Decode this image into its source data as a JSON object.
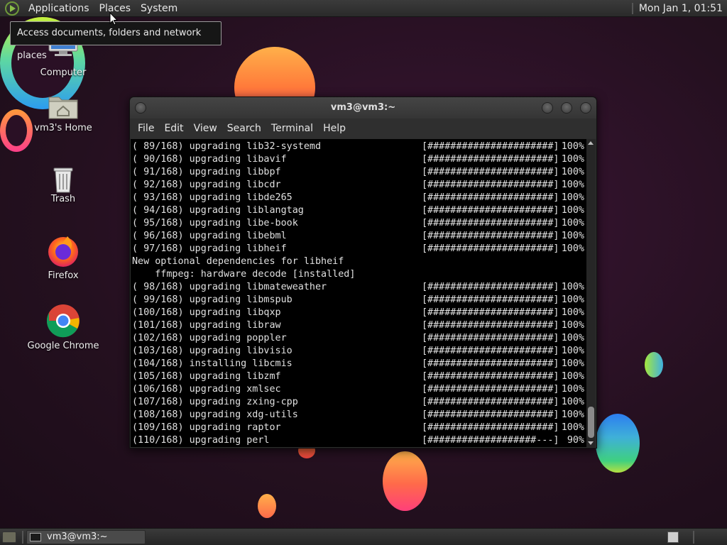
{
  "top_panel": {
    "menus": [
      "Applications",
      "Places",
      "System"
    ],
    "clock": "Mon Jan 1, 01:51"
  },
  "tooltip": "Access documents, folders and network places",
  "desktop_icons": [
    {
      "label": "Computer"
    },
    {
      "label": "vm3's Home"
    },
    {
      "label": "Trash"
    },
    {
      "label": "Firefox"
    },
    {
      "label": "Google Chrome"
    }
  ],
  "terminal": {
    "title": "vm3@vm3:~",
    "menus": [
      "File",
      "Edit",
      "View",
      "Search",
      "Terminal",
      "Help"
    ],
    "lines": [
      {
        "text": "( 89/168) upgrading lib32-systemd",
        "progress": "[######################]",
        "pct": "100%"
      },
      {
        "text": "( 90/168) upgrading libavif",
        "progress": "[######################]",
        "pct": "100%"
      },
      {
        "text": "( 91/168) upgrading libbpf",
        "progress": "[######################]",
        "pct": "100%"
      },
      {
        "text": "( 92/168) upgrading libcdr",
        "progress": "[######################]",
        "pct": "100%"
      },
      {
        "text": "( 93/168) upgrading libde265",
        "progress": "[######################]",
        "pct": "100%"
      },
      {
        "text": "( 94/168) upgrading liblangtag",
        "progress": "[######################]",
        "pct": "100%"
      },
      {
        "text": "( 95/168) upgrading libe-book",
        "progress": "[######################]",
        "pct": "100%"
      },
      {
        "text": "( 96/168) upgrading libebml",
        "progress": "[######################]",
        "pct": "100%"
      },
      {
        "text": "( 97/168) upgrading libheif",
        "progress": "[######################]",
        "pct": "100%"
      },
      {
        "text": "New optional dependencies for libheif",
        "progress": "",
        "pct": ""
      },
      {
        "text": "    ffmpeg: hardware decode [installed]",
        "progress": "",
        "pct": ""
      },
      {
        "text": "( 98/168) upgrading libmateweather",
        "progress": "[######################]",
        "pct": "100%"
      },
      {
        "text": "( 99/168) upgrading libmspub",
        "progress": "[######################]",
        "pct": "100%"
      },
      {
        "text": "(100/168) upgrading libqxp",
        "progress": "[######################]",
        "pct": "100%"
      },
      {
        "text": "(101/168) upgrading libraw",
        "progress": "[######################]",
        "pct": "100%"
      },
      {
        "text": "(102/168) upgrading poppler",
        "progress": "[######################]",
        "pct": "100%"
      },
      {
        "text": "(103/168) upgrading libvisio",
        "progress": "[######################]",
        "pct": "100%"
      },
      {
        "text": "(104/168) installing libcmis",
        "progress": "[######################]",
        "pct": "100%"
      },
      {
        "text": "(105/168) upgrading libzmf",
        "progress": "[######################]",
        "pct": "100%"
      },
      {
        "text": "(106/168) upgrading xmlsec",
        "progress": "[######################]",
        "pct": "100%"
      },
      {
        "text": "(107/168) upgrading zxing-cpp",
        "progress": "[######################]",
        "pct": "100%"
      },
      {
        "text": "(108/168) upgrading xdg-utils",
        "progress": "[######################]",
        "pct": "100%"
      },
      {
        "text": "(109/168) upgrading raptor",
        "progress": "[######################]",
        "pct": "100%"
      },
      {
        "text": "(110/168) upgrading perl",
        "progress": "[###################---]",
        "pct": "90%"
      }
    ]
  },
  "taskbar": {
    "window_title": "vm3@vm3:~"
  },
  "icons": {
    "app_logo": "mate-logo-icon",
    "computer": "monitor-icon",
    "home": "home-folder-icon",
    "trash": "trash-can-icon",
    "firefox": "firefox-icon",
    "chrome": "chrome-icon",
    "terminal": "terminal-icon"
  }
}
